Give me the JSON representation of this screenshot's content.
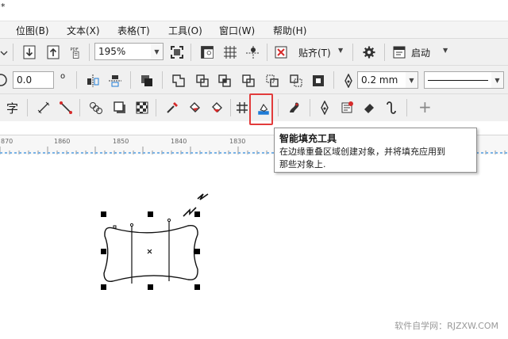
{
  "window": {
    "mark": "*"
  },
  "menu": {
    "items": [
      {
        "label": "位图(B)",
        "name": "menu-bitmap"
      },
      {
        "label": "文本(X)",
        "name": "menu-text"
      },
      {
        "label": "表格(T)",
        "name": "menu-table"
      },
      {
        "label": "工具(O)",
        "name": "menu-tools"
      },
      {
        "label": "窗口(W)",
        "name": "menu-window"
      },
      {
        "label": "帮助(H)",
        "name": "menu-help"
      }
    ]
  },
  "standard_toolbar": {
    "pdf_label": "PDF",
    "zoom_value": "195%",
    "snap_label": "贴齐(T)",
    "launch_label": "启动"
  },
  "property_bar": {
    "position_value": "0.0",
    "outline_width": "0.2 mm"
  },
  "toolbox": {
    "text_tool_label": "字",
    "add_label": "+"
  },
  "ruler": {
    "labels": [
      "870",
      "1860",
      "1850",
      "1840",
      "1830"
    ]
  },
  "tooltip": {
    "title": "智能填充工具",
    "line1": "在边缘重叠区域创建对象，并将填充应用到",
    "line2": "那些对象上."
  },
  "watermark": "软件自学网：RJZXW.COM",
  "colors": {
    "highlight": "#e23b3b",
    "toolbar_bg": "#f0f0f0"
  }
}
